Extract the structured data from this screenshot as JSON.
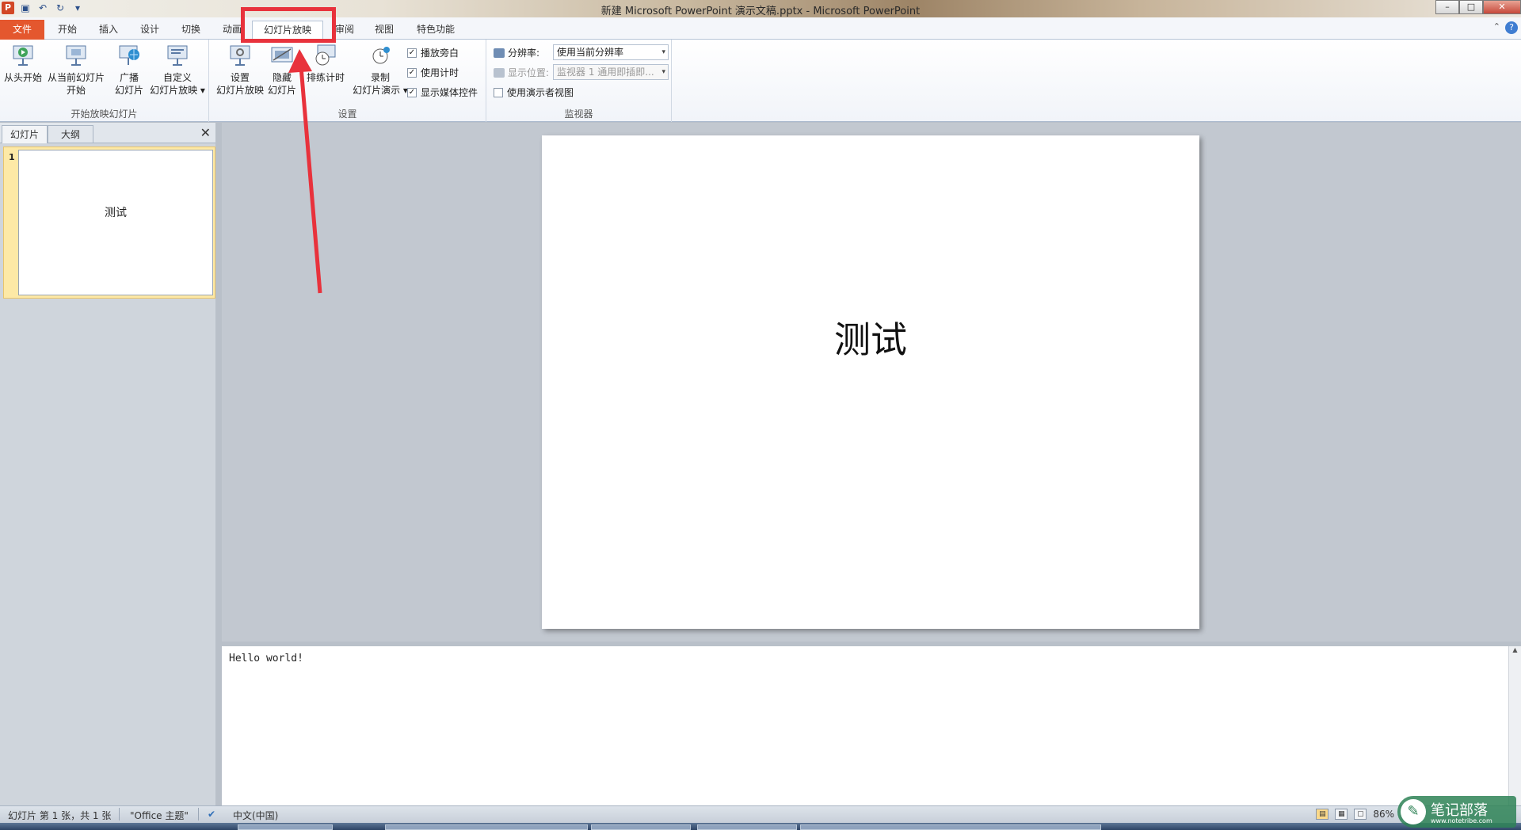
{
  "window": {
    "title": "新建 Microsoft PowerPoint 演示文稿.pptx - Microsoft PowerPoint",
    "app_icon": "P",
    "qat_icons": [
      "save-icon",
      "undo-icon",
      "redo-icon",
      "customize-icon"
    ],
    "controls": {
      "minimize": "–",
      "restore": "□",
      "close": "✕"
    }
  },
  "ribbon_tabs": [
    {
      "label": "文件",
      "name": "tab-file"
    },
    {
      "label": "开始",
      "name": "tab-home"
    },
    {
      "label": "插入",
      "name": "tab-insert"
    },
    {
      "label": "设计",
      "name": "tab-design"
    },
    {
      "label": "切换",
      "name": "tab-transitions"
    },
    {
      "label": "动画",
      "name": "tab-animations"
    },
    {
      "label": "幻灯片放映",
      "name": "tab-slideshow",
      "active": true
    },
    {
      "label": "审阅",
      "name": "tab-review"
    },
    {
      "label": "视图",
      "name": "tab-view"
    },
    {
      "label": "特色功能",
      "name": "tab-features"
    }
  ],
  "ribbon": {
    "group_start": {
      "label": "开始放映幻灯片",
      "buttons": {
        "from_beginning": "从头开始",
        "from_current_1": "从当前幻灯片",
        "from_current_2": "开始",
        "broadcast_1": "广播",
        "broadcast_2": "幻灯片",
        "custom_1": "自定义",
        "custom_2": "幻灯片放映 ▾"
      }
    },
    "group_setup": {
      "label": "设置",
      "buttons": {
        "setup_1": "设置",
        "setup_2": "幻灯片放映",
        "hide_1": "隐藏",
        "hide_2": "幻灯片",
        "rehearse": "排练计时",
        "record_1": "录制",
        "record_2": "幻灯片演示 ▾"
      },
      "checks": {
        "narration": "播放旁白",
        "timings": "使用计时",
        "media_controls": "显示媒体控件"
      }
    },
    "group_monitors": {
      "label": "监视器",
      "resolution_label": "分辨率:",
      "resolution_value": "使用当前分辨率",
      "show_on_label": "显示位置:",
      "show_on_value": "监视器 1  通用即插即...",
      "presenter_view": "使用演示者视图"
    }
  },
  "left_panel": {
    "tabs": [
      "幻灯片",
      "大纲"
    ],
    "close": "✕",
    "slides": [
      {
        "number": "1",
        "title": "测试"
      }
    ]
  },
  "slide": {
    "title": "测试"
  },
  "notes": {
    "text": "Hello world!"
  },
  "status": {
    "slide_info": "幻灯片 第 1 张，共 1 张",
    "theme": "\"Office 主题\"",
    "language": "中文(中国)",
    "zoom": "86%"
  },
  "watermark": {
    "text": "笔记部落",
    "url": "www.notetribe.com"
  },
  "colors": {
    "file_tab": "#e4572e",
    "annotation": "#e8323c",
    "selected_thumb": "#fde9a6"
  }
}
